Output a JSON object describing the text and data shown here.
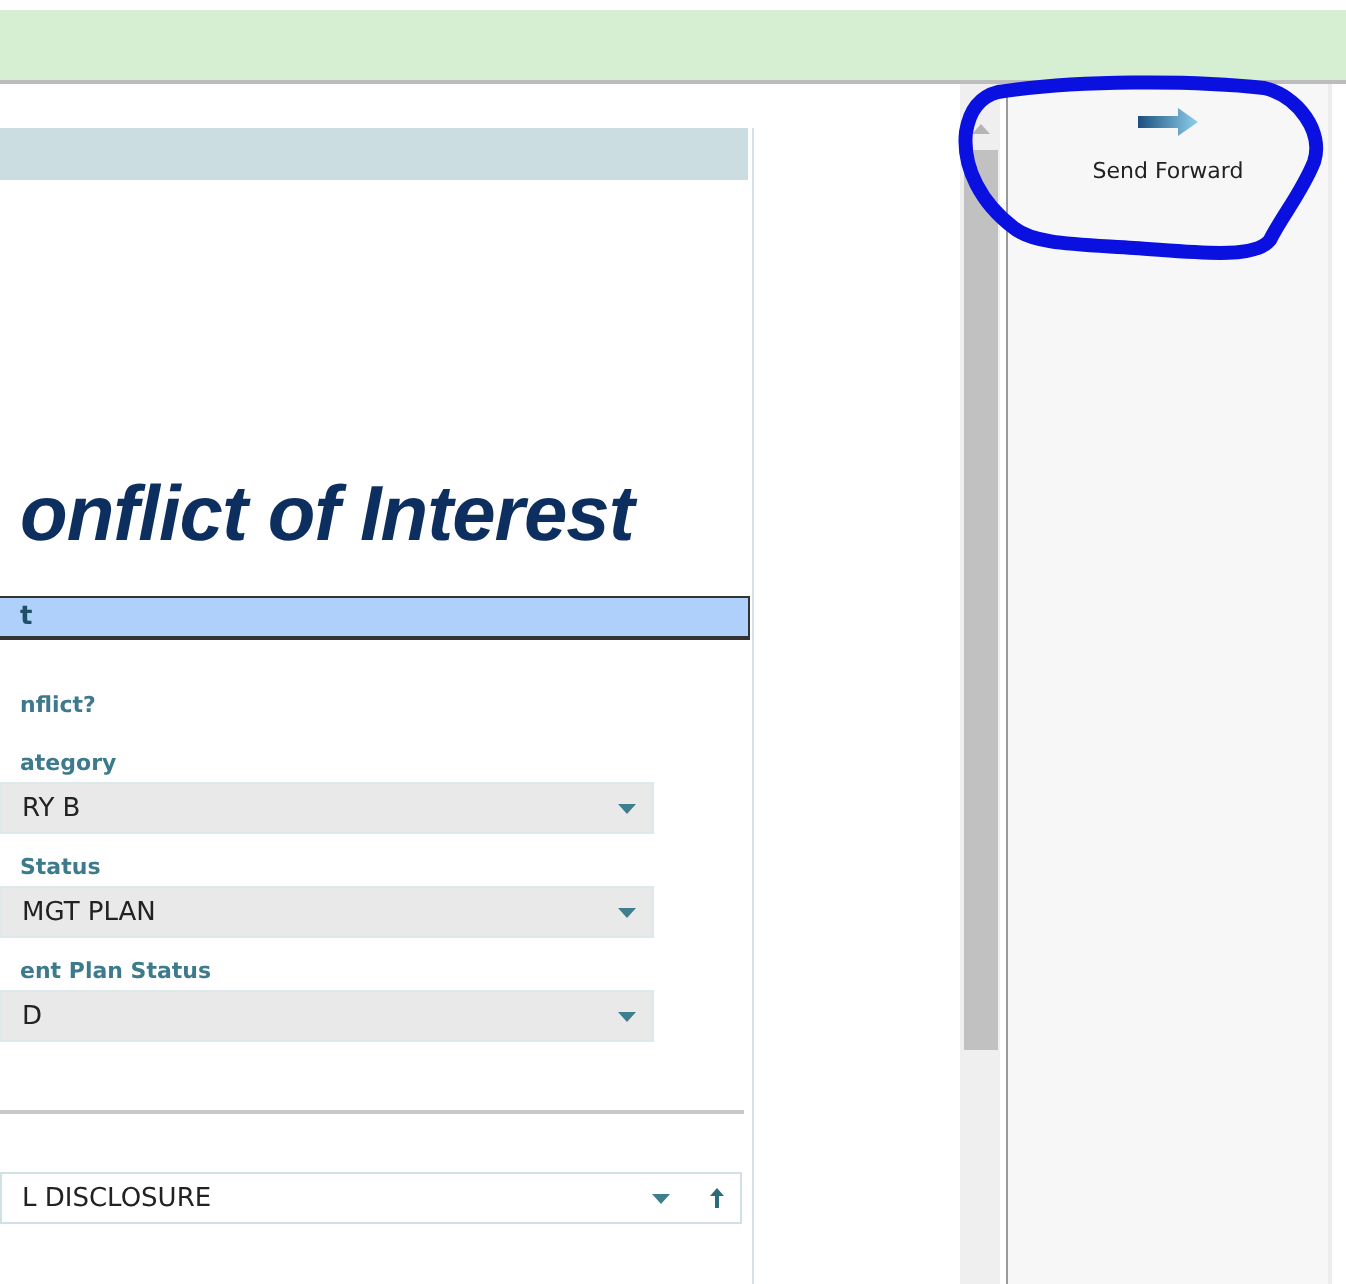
{
  "form": {
    "title": "onflict of Interest",
    "section": "t",
    "question": "nflict?",
    "fields": [
      {
        "label": "ategory",
        "value": "RY B"
      },
      {
        "label": "Status",
        "value": "MGT PLAN"
      },
      {
        "label": "ent Plan Status",
        "value": "D"
      }
    ],
    "bottom_select": {
      "value": "L DISCLOSURE"
    }
  },
  "side_pane": {
    "actions": [
      {
        "label": "Send Forward"
      }
    ]
  }
}
